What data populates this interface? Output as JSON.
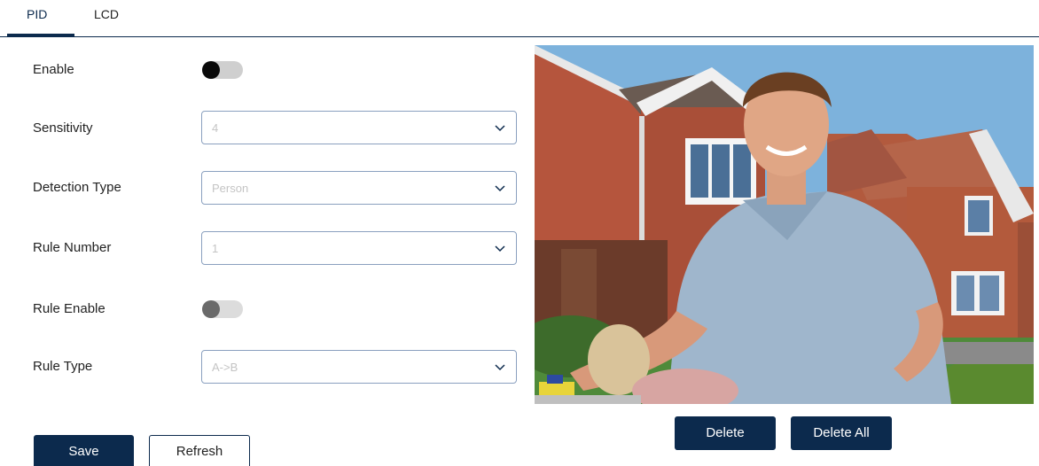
{
  "tabs": [
    {
      "label": "PID",
      "active": true
    },
    {
      "label": "LCD",
      "active": false
    }
  ],
  "form": {
    "enable": {
      "label": "Enable",
      "on": false
    },
    "sensitivity": {
      "label": "Sensitivity",
      "value": "4"
    },
    "detection_type": {
      "label": "Detection Type",
      "value": "Person"
    },
    "rule_number": {
      "label": "Rule Number",
      "value": "1"
    },
    "rule_enable": {
      "label": "Rule Enable",
      "on": false
    },
    "rule_type": {
      "label": "Rule Type",
      "value": "A->B"
    }
  },
  "buttons": {
    "save": "Save",
    "refresh": "Refresh",
    "delete": "Delete",
    "delete_all": "Delete All"
  },
  "colors": {
    "accent": "#0c2a4d",
    "select_border": "#8aa0bf",
    "placeholder_text": "#c4c4c4"
  },
  "icons": {
    "dropdown": "chevron-down-icon"
  }
}
